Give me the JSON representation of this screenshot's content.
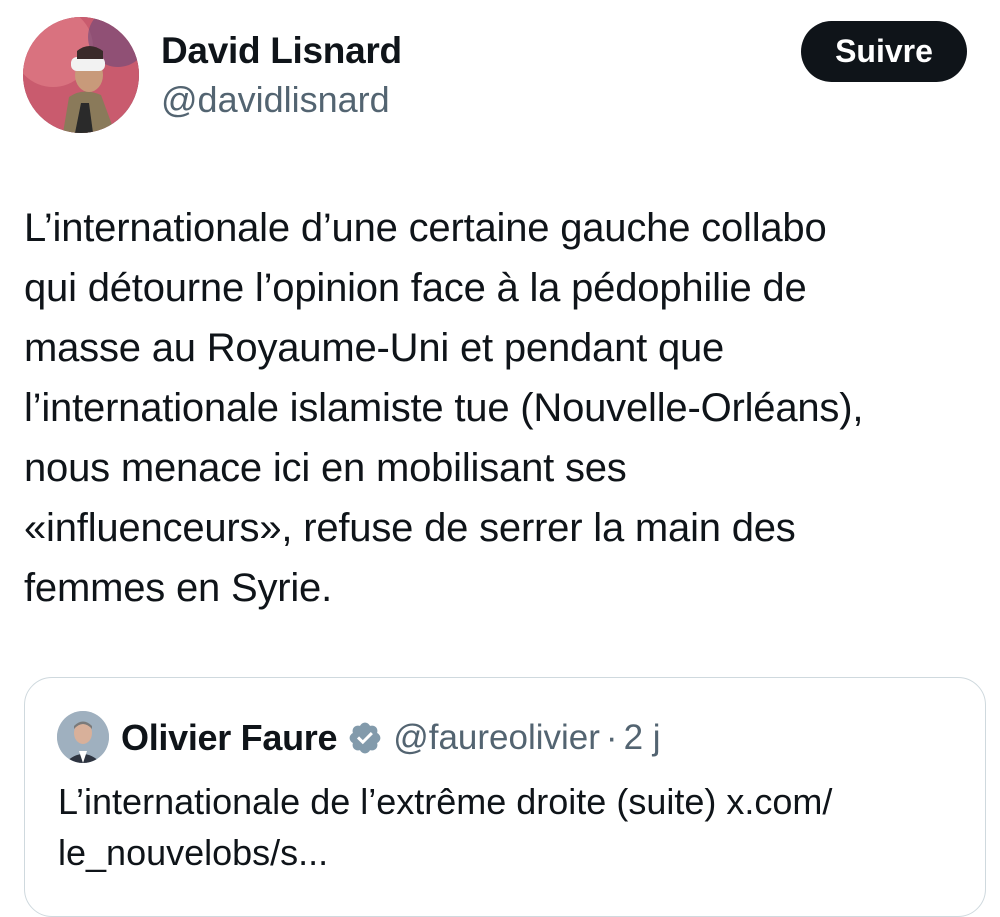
{
  "tweet": {
    "author_name": "David Lisnard",
    "author_handle": "@davidlisnard",
    "follow_label": "Suivre",
    "text": "L’internationale d’une certaine gauche collabo\nqui détourne l’opinion face à la pédophilie de\nmasse au Royaume-Uni et pendant que\nl’internationale islamiste tue (Nouvelle-Orléans),\nnous menace ici en mobilisant ses\n«influenceurs», refuse de serrer la main des\nfemmes en Syrie."
  },
  "quoted": {
    "author_name": "Olivier Faure",
    "verified_icon": "verified-badge-icon",
    "author_handle": "@faureolivier",
    "separator": "·",
    "time": "2 j",
    "text": "L’internationale de l’extrême droite (suite) x.com/\nle_nouvelobs/s..."
  },
  "colors": {
    "text": "#0f1419",
    "secondary": "#536471",
    "border": "#cfd9de",
    "follow_bg": "#0f1419"
  }
}
